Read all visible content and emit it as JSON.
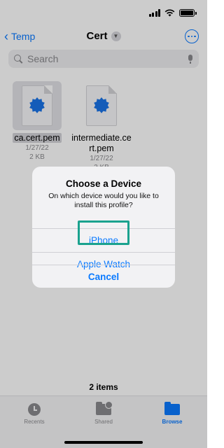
{
  "status_bar": {
    "icons": [
      "cellular-signal-icon",
      "wifi-icon",
      "battery-icon"
    ]
  },
  "nav": {
    "back_label": "Temp",
    "title": "Cert",
    "accent_color": "#0a7aff"
  },
  "search": {
    "placeholder": "Search"
  },
  "files": [
    {
      "name": "ca.cert.pem",
      "date": "1/27/22",
      "size": "2 KB",
      "selected": true
    },
    {
      "name": "intermediate.cert.pem",
      "name_line1": "intermediate.ce",
      "name_line2": "rt.pem",
      "date": "1/27/22",
      "size": "2 KB"
    }
  ],
  "alert": {
    "title": "Choose a Device",
    "message": "On which device would you like to install this profile?",
    "buttons": {
      "iphone": "iPhone",
      "watch": "Apple Watch",
      "cancel": "Cancel"
    },
    "highlight_color": "#1aa28e"
  },
  "items_count": "2 items",
  "tab_bar": {
    "recents": "Recents",
    "shared": "Shared",
    "browse": "Browse",
    "active": "Browse"
  }
}
